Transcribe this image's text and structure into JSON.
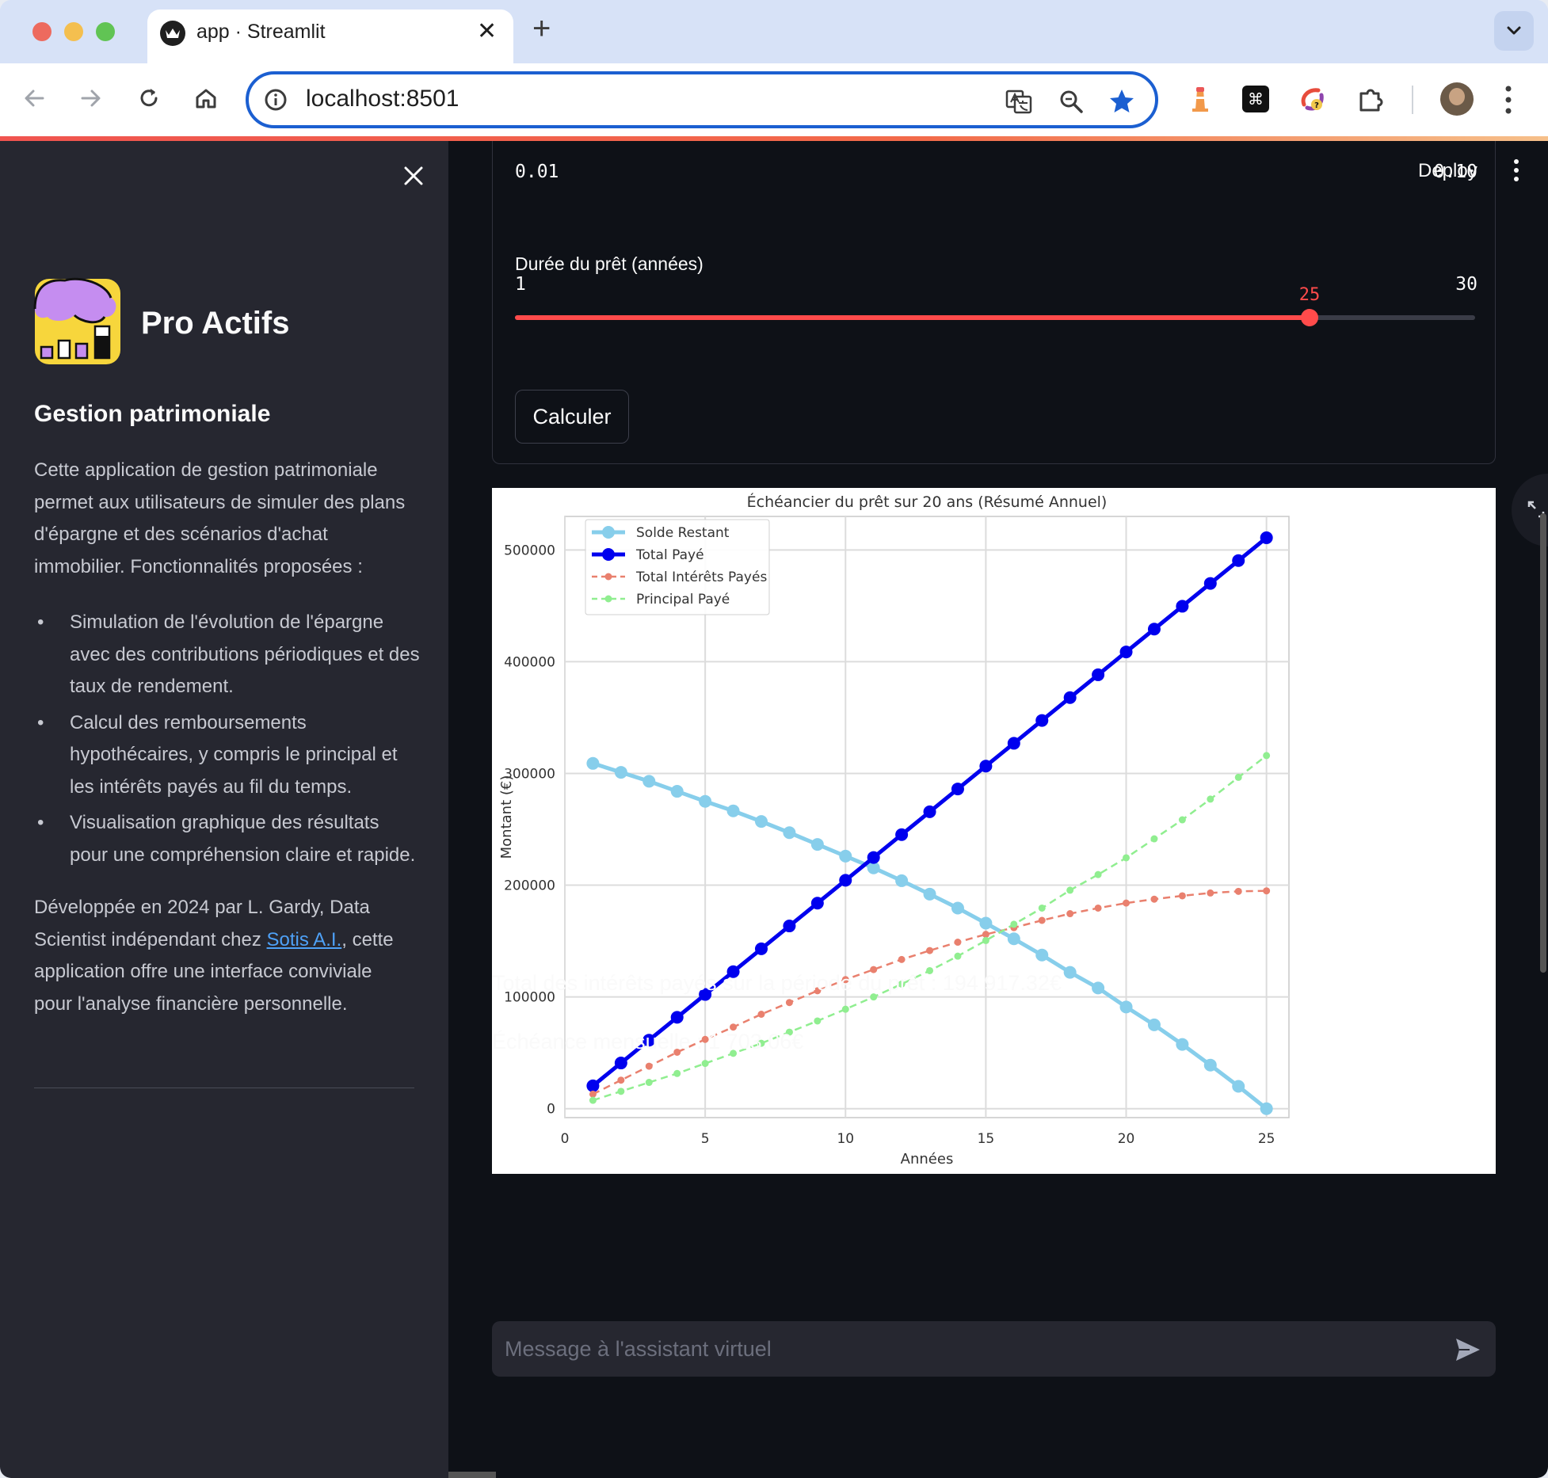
{
  "browser": {
    "tab_title": "app · Streamlit",
    "url": "localhost:8501"
  },
  "sidebar": {
    "brand": "Pro Actifs",
    "heading": "Gestion patrimoniale",
    "intro": "Cette application de gestion patrimoniale permet aux utilisateurs de simuler des plans d'épargne et des scénarios d'achat immobilier. Fonctionnalités proposées :",
    "features": [
      "Simulation de l'évolution de l'épargne avec des contributions périodiques et des taux de rendement.",
      "Calcul des remboursements hypothécaires, y compris le principal et les intérêts payés au fil du temps.",
      "Visualisation graphique des résultats pour une compréhension claire et rapide."
    ],
    "credit_before": "Développée en 2024 par L. Gardy, Data Scientist indépendant chez ",
    "credit_link": "Sotis A.I.",
    "credit_after": ", cette application offre une interface conviviale pour l'analyse financière personnelle."
  },
  "header": {
    "deploy_label": "Deploy"
  },
  "form": {
    "rate_min": "0.01",
    "rate_max": "0.10",
    "duration_label": "Durée du prêt (années)",
    "duration_value": 25,
    "duration_min": 1,
    "duration_max": 30,
    "duration_value_text": "25",
    "duration_min_text": "1",
    "duration_max_text": "30",
    "calc_label": "Calculer"
  },
  "results": {
    "interest_total": "Total des intérêts payés sur la période du prêt : 194 917.32€",
    "monthly": "Échéance mensuelle : 1 703.06€"
  },
  "chat": {
    "placeholder": "Message à l'assistant virtuel"
  },
  "chart_data": {
    "type": "line",
    "title": "Échéancier du prêt sur 20 ans (Résumé Annuel)",
    "xlabel": "Années",
    "ylabel": "Montant (€)",
    "xlim": [
      0,
      25.8
    ],
    "ylim": [
      -8000,
      530000
    ],
    "xticks": [
      0,
      5,
      10,
      15,
      20,
      25
    ],
    "yticks": [
      0,
      100000,
      200000,
      300000,
      400000,
      500000
    ],
    "grid": true,
    "legend_position": "upper left",
    "x": [
      1,
      2,
      3,
      4,
      5,
      6,
      7,
      8,
      9,
      10,
      11,
      12,
      13,
      14,
      15,
      16,
      17,
      18,
      19,
      20,
      21,
      22,
      23,
      24,
      25
    ],
    "series": [
      {
        "name": "Solde Restant",
        "color": "#87ceeb",
        "style": "solid-large-marker",
        "values": [
          309000,
          301000,
          293000,
          284000,
          275000,
          266500,
          257000,
          247000,
          236500,
          226000,
          215500,
          204000,
          192000,
          179500,
          166000,
          152000,
          137500,
          122000,
          108000,
          91000,
          75000,
          57500,
          39000,
          20000,
          0
        ]
      },
      {
        "name": "Total Payé",
        "color": "#0000ee",
        "style": "solid-large-marker",
        "values": [
          20437,
          40873,
          61310,
          81747,
          102183,
          122620,
          143057,
          163494,
          183930,
          204367,
          224804,
          245240,
          265677,
          286114,
          306550,
          326987,
          347424,
          367860,
          388297,
          408734,
          429170,
          449607,
          470044,
          490480,
          510917
        ]
      },
      {
        "name": "Total Intérêts Payés",
        "color": "#e9806e",
        "style": "dashed-small-marker",
        "values": [
          13000,
          25500,
          38000,
          50500,
          62000,
          73000,
          84500,
          95000,
          105500,
          115500,
          124500,
          133500,
          141500,
          149000,
          156000,
          162000,
          168500,
          174500,
          179500,
          184000,
          187500,
          190500,
          193000,
          194500,
          194917
        ]
      },
      {
        "name": "Principal Payé",
        "color": "#90ee90",
        "style": "dashed-small-marker",
        "values": [
          7500,
          15500,
          23500,
          31500,
          40500,
          49500,
          58500,
          68500,
          78500,
          89000,
          100000,
          111500,
          123500,
          136500,
          150500,
          165000,
          179500,
          195500,
          209500,
          224500,
          241500,
          258500,
          277000,
          296500,
          316000
        ]
      }
    ]
  }
}
